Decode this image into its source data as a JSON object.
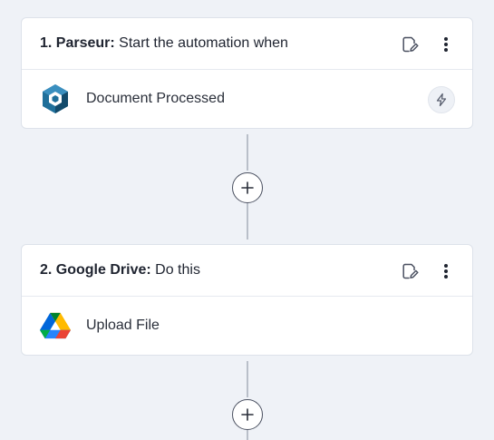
{
  "steps": [
    {
      "number_app": "1. Parseur:",
      "description": "Start the automation when",
      "action": "Document Processed",
      "app_icon": "parseur-logo-icon",
      "has_trigger_badge": true
    },
    {
      "number_app": "2. Google Drive:",
      "description": "Do this",
      "action": "Upload File",
      "app_icon": "google-drive-logo-icon",
      "has_trigger_badge": false
    }
  ],
  "icons": {
    "edit": "edit-note-icon",
    "more": "more-vertical-icon",
    "trigger": "lightning-bolt-icon",
    "add": "plus-icon"
  },
  "colors": {
    "background": "#eff2f7",
    "card": "#ffffff",
    "connector": "#b9bfc9",
    "parseur_blue": "#1f6f9a",
    "parseur_dark": "#124a6b"
  }
}
